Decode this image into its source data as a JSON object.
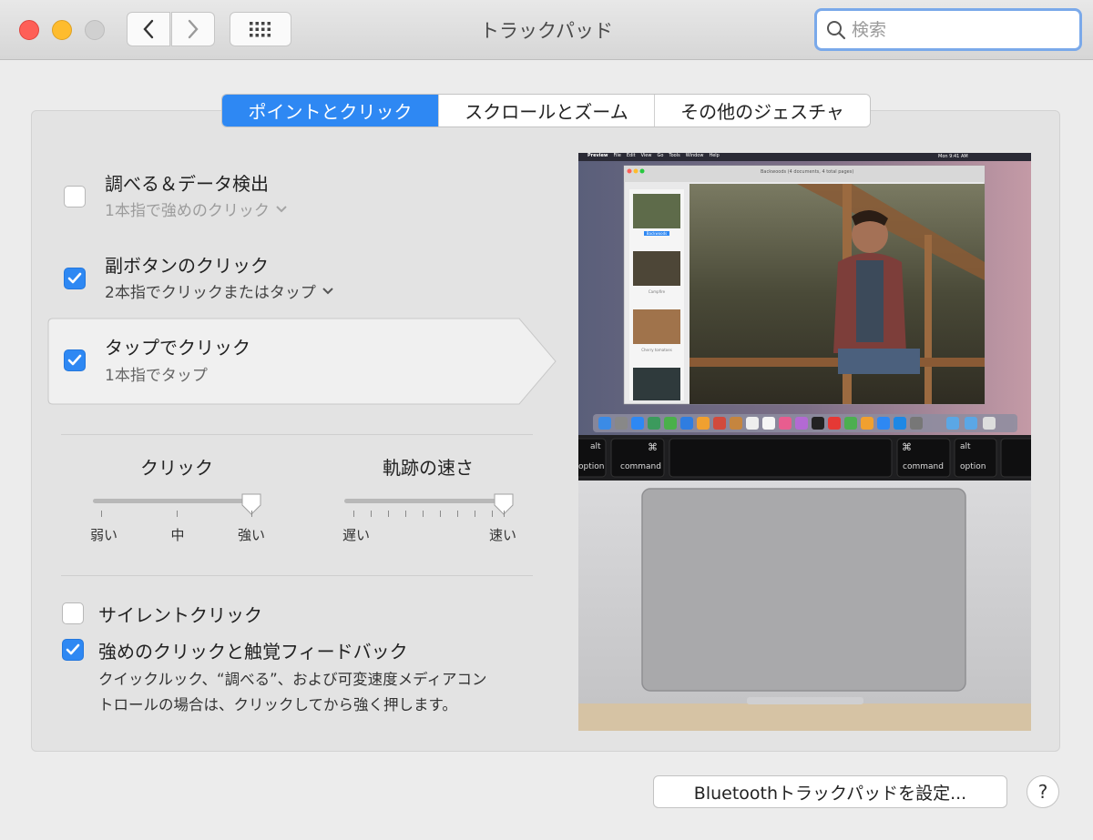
{
  "window": {
    "title": "トラックパッド",
    "search_placeholder": "検索"
  },
  "tabs": [
    {
      "label": "ポイントとクリック",
      "active": true
    },
    {
      "label": "スクロールとズーム",
      "active": false
    },
    {
      "label": "その他のジェスチャ",
      "active": false
    }
  ],
  "options": {
    "lookup": {
      "title": "調べる＆データ検出",
      "subtitle": "1本指で強めのクリック",
      "checked": false
    },
    "secondary": {
      "title": "副ボタンのクリック",
      "subtitle": "2本指でクリックまたはタップ",
      "checked": true
    },
    "tap": {
      "title": "タップでクリック",
      "subtitle": "1本指でタップ",
      "checked": true
    }
  },
  "sliders": {
    "click": {
      "title": "クリック",
      "labels": [
        "弱い",
        "中",
        "強い"
      ],
      "value": "強い"
    },
    "speed": {
      "title": "軌跡の速さ",
      "labels": [
        "遅い",
        "速い"
      ],
      "value_fraction": 0.93
    }
  },
  "bottom_options": {
    "silent": {
      "label": "サイレントクリック",
      "checked": false
    },
    "force": {
      "label": "強めのクリックと触覚フィードバック",
      "checked": true,
      "description_line1": "クイックルック、“調べる”、および可変速度メディアコン",
      "description_line2": "トロールの場合は、クリックしてから強く押します。"
    }
  },
  "preview": {
    "menubar_items": [
      "Preview",
      "File",
      "Edit",
      "View",
      "Go",
      "Tools",
      "Window",
      "Help"
    ],
    "menubar_clock": "Mon 9:41 AM",
    "doc_title": "Backwoods (4 documents, 4 total pages)",
    "thumbnails": [
      "Backwoods",
      "Campfire",
      "Cherry tomatoes"
    ],
    "keys": {
      "left_alt": "alt",
      "left_option": "option",
      "left_cmd_symbol": "⌘",
      "left_command": "command",
      "right_cmd_symbol": "⌘",
      "right_command": "command",
      "right_alt": "alt",
      "right_option": "option"
    }
  },
  "buttons": {
    "bluetooth": "Bluetoothトラックパッドを設定...",
    "help": "?"
  }
}
